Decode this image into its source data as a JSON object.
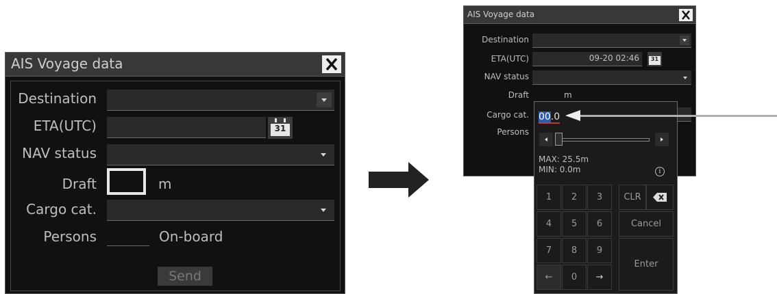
{
  "left_dialog": {
    "title": "AIS Voyage data",
    "close_icon": "x-icon",
    "labels": {
      "destination": "Destination",
      "eta": "ETA(UTC)",
      "nav_status": "NAV status",
      "draft": "Draft",
      "cargo": "Cargo cat.",
      "persons": "Persons"
    },
    "draft_unit": "m",
    "persons_unit": "On-board",
    "calendar_day": "31",
    "send_label": "Send"
  },
  "right_dialog": {
    "title": "AIS Voyage data",
    "labels": {
      "destination": "Destination",
      "eta": "ETA(UTC)",
      "nav_status": "NAV status",
      "draft": "Draft",
      "cargo": "Cargo cat.",
      "persons": "Persons"
    },
    "eta_value": "09-20 02:46",
    "draft_unit": "m",
    "calendar_day": "31"
  },
  "keypad": {
    "value_selected": "00",
    "value_rest": ".0",
    "max_label": "MAX: 25.5m",
    "min_label": "MIN: 0.0m",
    "slider_fraction": 0.0,
    "keys": {
      "k1": "1",
      "k2": "2",
      "k3": "3",
      "k4": "4",
      "k5": "5",
      "k6": "6",
      "k7": "7",
      "k8": "8",
      "k9": "9",
      "k0": "0",
      "left": "←",
      "right": "→",
      "clr": "CLR",
      "cancel": "Cancel",
      "enter": "Enter"
    },
    "icons": [
      "info-icon",
      "backspace-icon",
      "slider-left-icon",
      "slider-right-icon"
    ]
  },
  "colors": {
    "dialog_bg": "#111111",
    "titlebar_bg": "#383838",
    "text": "#bfbfbf",
    "highlight_blue": "#2a5db0",
    "underline_red": "#c0392b"
  }
}
